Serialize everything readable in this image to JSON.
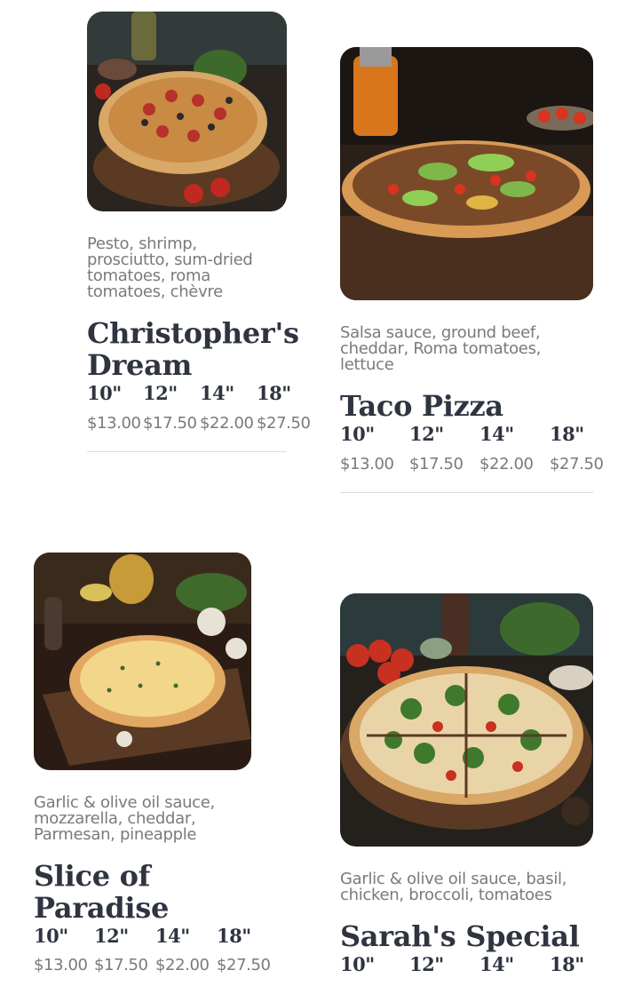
{
  "menu": {
    "items": [
      {
        "name": "Christopher's Dream",
        "name_line1": "Christopher's",
        "name_line2": "Dream",
        "description": [
          "Pesto, shrimp,",
          "prosciutto, sum-dried",
          "tomatoes, roma",
          "tomatoes, chèvre"
        ],
        "sizes": [
          "10\"",
          "12\"",
          "14\"",
          "18\""
        ],
        "prices": [
          "$13.00",
          "$17.50",
          "$22.00",
          "$27.50"
        ]
      },
      {
        "name": "Taco Pizza",
        "name_line1": "Taco Pizza",
        "description": [
          "Salsa sauce, ground beef,",
          "cheddar, Roma tomatoes,",
          "lettuce"
        ],
        "sizes": [
          "10\"",
          "12\"",
          "14\"",
          "18\""
        ],
        "prices": [
          "$13.00",
          "$17.50",
          "$22.00",
          "$27.50"
        ]
      },
      {
        "name": "Slice of Paradise",
        "name_line1": "Slice of",
        "name_line2": "Paradise",
        "description": [
          "Garlic & olive oil sauce,",
          "mozzarella, cheddar,",
          "Parmesan, pineapple"
        ],
        "sizes": [
          "10\"",
          "12\"",
          "14\"",
          "18\""
        ],
        "prices": [
          "$13.00",
          "$17.50",
          "$22.00",
          "$27.50"
        ]
      },
      {
        "name": "Sarah's Special",
        "name_line1": "Sarah's Special",
        "description": [
          "Garlic & olive oil sauce, basil,",
          "chicken, broccoli, tomatoes"
        ],
        "sizes": [
          "10\"",
          "12\"",
          "14\"",
          "18\""
        ],
        "prices": []
      }
    ]
  },
  "colors": {
    "title": "#2f3440",
    "text_muted": "#7a7a7a",
    "divider": "#dcdcdc",
    "photo_background": "#2a1f18"
  }
}
